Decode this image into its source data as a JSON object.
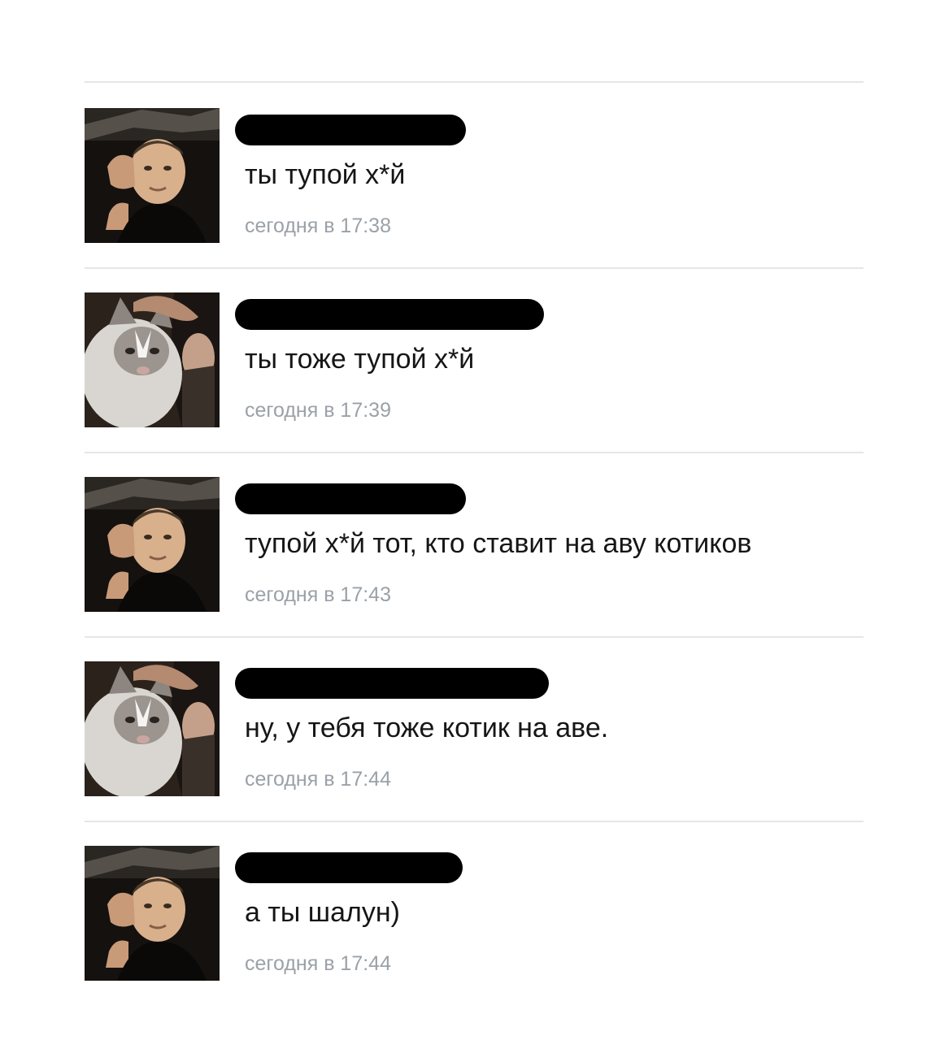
{
  "messages": [
    {
      "author_avatar": "man-photo-avatar",
      "text": "ты тупой х*й",
      "time": "сегодня в 17:38"
    },
    {
      "author_avatar": "cat-photo-avatar",
      "text": "ты тоже тупой х*й",
      "time": "сегодня в 17:39"
    },
    {
      "author_avatar": "man-photo-avatar",
      "text": "тупой х*й тот, кто ставит на аву котиков",
      "time": "сегодня в 17:43"
    },
    {
      "author_avatar": "cat-photo-avatar",
      "text": "ну, у тебя тоже котик на аве.",
      "time": "сегодня в 17:44"
    },
    {
      "author_avatar": "man-photo-avatar",
      "text": "а ты шалун)",
      "time": "сегодня в 17:44"
    }
  ],
  "colors": {
    "background": "#ffffff",
    "message_text": "#161616",
    "timestamp_text": "#9aa1a8",
    "divider": "#e4e6ea",
    "redaction_bar": "#000000"
  }
}
